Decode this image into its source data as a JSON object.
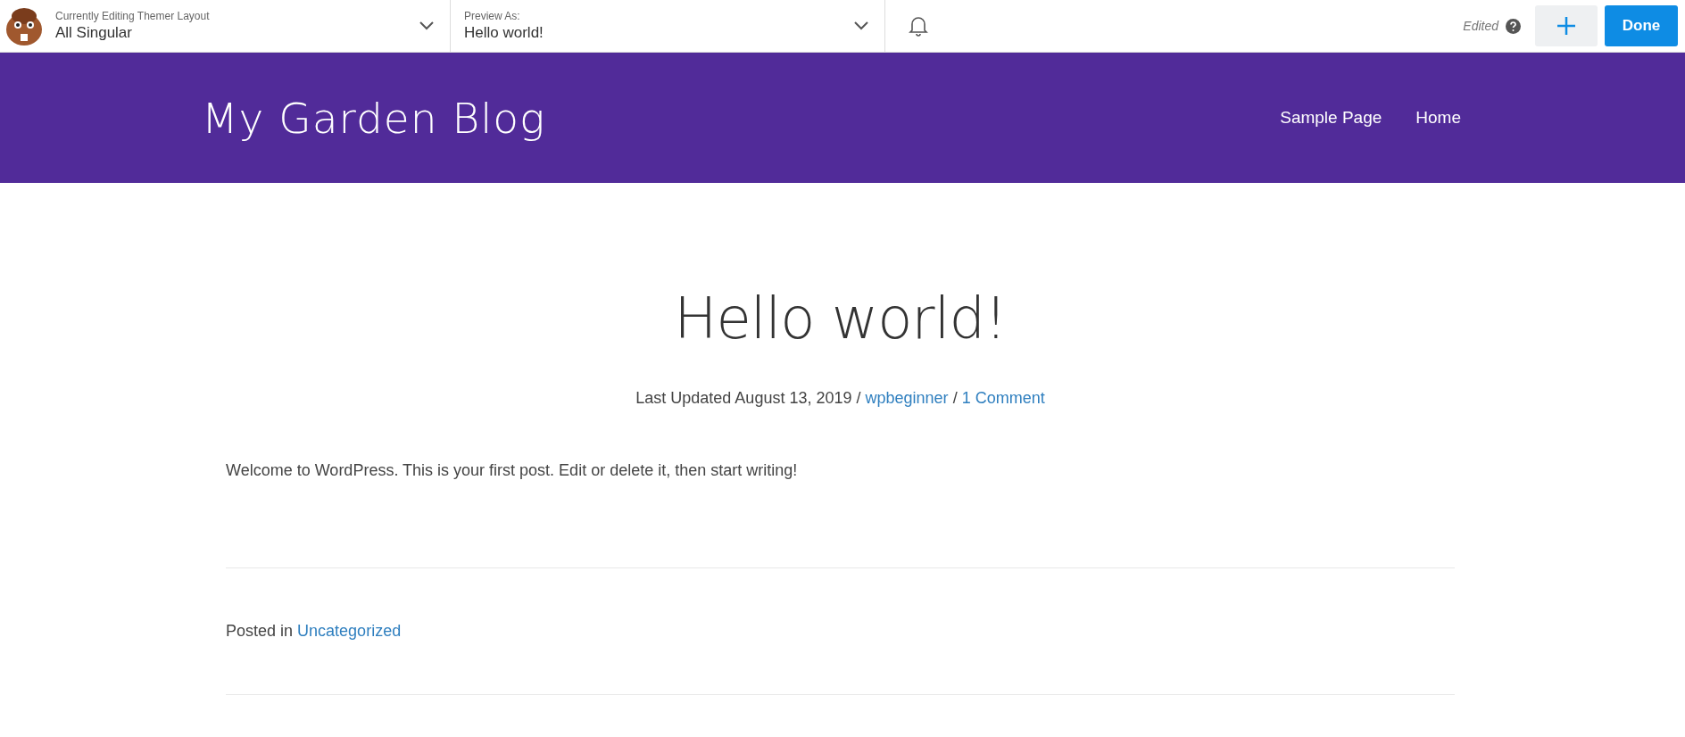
{
  "toolbar": {
    "layout_label": "Currently Editing Themer Layout",
    "layout_value": "All Singular",
    "preview_label": "Preview As:",
    "preview_value": "Hello world!",
    "status": "Edited",
    "done_button": "Done"
  },
  "site_header": {
    "title": "My Garden Blog",
    "nav": [
      "Sample Page",
      "Home"
    ]
  },
  "post": {
    "title": "Hello world!",
    "meta": {
      "date": "Last Updated August 13, 2019",
      "separator_1": "/",
      "author": "wpbeginner",
      "separator_2": "/",
      "comments": "1 Comment"
    },
    "body": "Welcome to WordPress. This is your first post. Edit or delete it, then start writing!",
    "footer": {
      "prefix": "Posted in",
      "category": "Uncategorized"
    }
  }
}
